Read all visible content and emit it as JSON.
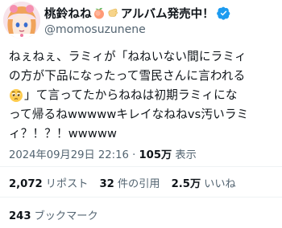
{
  "author": {
    "display_name": "桃鈴ねね",
    "name_suffix": "アルバム発売中！",
    "handle": "@momosuzunene",
    "name_emojis": [
      "peach-emoji",
      "hand-emoji"
    ],
    "verified": true,
    "verified_color": "#1d9bf0"
  },
  "tweet": {
    "lines": [
      "ねぇねぇ、ラミィが「ねねいない間にラミィ",
      "の方が下品になったって雪民さんに言われる",
      "」て言ってたからねねは初期ラミィにな",
      "って帰るねwwwwwキレイなねねvs汚いラミ",
      "ィ？！？！wwwww"
    ],
    "inline_emoji": "pleading-face-emoji"
  },
  "meta": {
    "timestamp": "2024年09月29日 22:16",
    "separator": "·",
    "views_count": "105万",
    "views_label": "表示"
  },
  "stats": {
    "reposts_count": "2,072",
    "reposts_label": "リポスト",
    "quotes_count": "32",
    "quotes_label": "件の引用",
    "likes_count": "2.5万",
    "likes_label": "いいね",
    "bookmarks_count": "243",
    "bookmarks_label": "ブックマーク"
  },
  "colors": {
    "text_primary": "#0f1419",
    "text_secondary": "#536471",
    "divider": "#eff3f4",
    "accent": "#1d9bf0"
  }
}
